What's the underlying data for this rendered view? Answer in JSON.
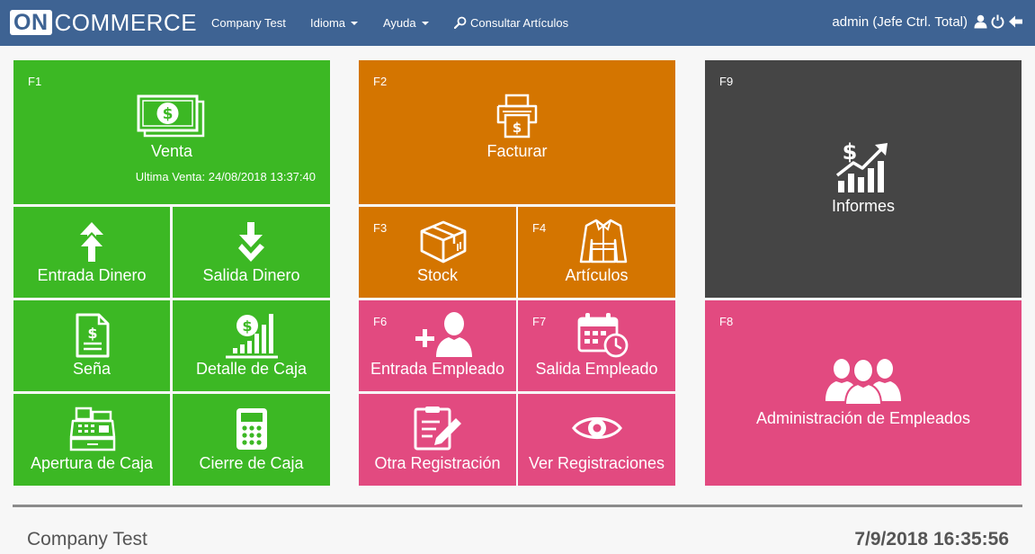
{
  "app": {
    "logo_on": "ON",
    "logo_rest": "COMMERCE"
  },
  "nav": {
    "company": "Company Test",
    "language": "Idioma",
    "help": "Ayuda",
    "search": "Consultar Artículos"
  },
  "user": {
    "label": "admin (Jefe Ctrl. Total)"
  },
  "tiles": {
    "venta": {
      "key": "F1",
      "label": "Venta",
      "sub": "Ultima Venta: 24/08/2018 13:37:40"
    },
    "entrada_dinero": {
      "label": "Entrada Dinero"
    },
    "salida_dinero": {
      "label": "Salida Dinero"
    },
    "sena": {
      "label": "Seña"
    },
    "detalle_caja": {
      "label": "Detalle de Caja"
    },
    "apertura_caja": {
      "label": "Apertura de Caja"
    },
    "cierre_caja": {
      "label": "Cierre de Caja"
    },
    "facturar": {
      "key": "F2",
      "label": "Facturar"
    },
    "stock": {
      "key": "F3",
      "label": "Stock"
    },
    "articulos": {
      "key": "F4",
      "label": "Artículos"
    },
    "entrada_empleado": {
      "key": "F6",
      "label": "Entrada Empleado"
    },
    "salida_empleado": {
      "key": "F7",
      "label": "Salida Empleado"
    },
    "otra_registracion": {
      "label": "Otra Registración"
    },
    "ver_registraciones": {
      "label": "Ver Registraciones"
    },
    "informes": {
      "key": "F9",
      "label": "Informes"
    },
    "admin_empleados": {
      "key": "F8",
      "label": "Administración de Empleados"
    }
  },
  "footer": {
    "company": "Company Test",
    "datetime": "7/9/2018 16:35:56"
  },
  "colors": {
    "topbar": "#3e6393",
    "green": "#3cb824",
    "orange": "#d47500",
    "pink": "#e24a80",
    "dark": "#454545"
  },
  "icons": {
    "venta": "cash-icon",
    "entrada_dinero": "double-up-arrow-icon",
    "salida_dinero": "double-down-arrow-icon",
    "sena": "receipt-icon",
    "detalle_caja": "money-chart-icon",
    "apertura_caja": "cash-register-icon",
    "cierre_caja": "calculator-icon",
    "facturar": "printer-icon",
    "stock": "box-icon",
    "articulos": "jacket-icon",
    "entrada_empleado": "add-user-icon",
    "salida_empleado": "calendar-clock-icon",
    "otra_registracion": "edit-document-icon",
    "ver_registraciones": "eye-icon",
    "informes": "growth-chart-icon",
    "admin_empleados": "users-group-icon"
  }
}
